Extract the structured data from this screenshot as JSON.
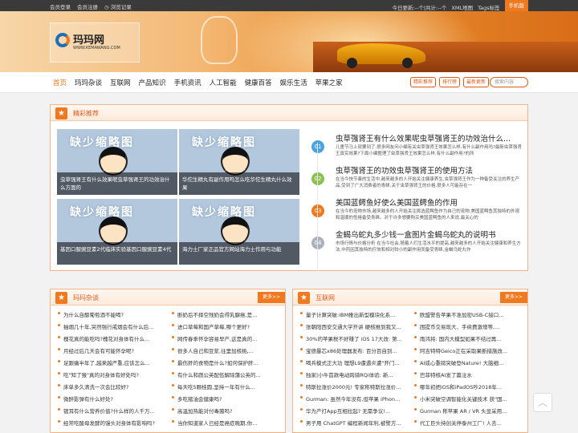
{
  "topbar": {
    "login": "会员登录",
    "register": "会员注册",
    "history": "浏览记录",
    "update": "今日更新:--个|共计:--个",
    "xml": "XML地图",
    "tags": "Tags标签",
    "mobile": "手机版"
  },
  "logo": {
    "name": "玛玛网",
    "url": "WWW.KEMAWANG.COM"
  },
  "nav": {
    "items": [
      "首页",
      "玛玛杂谈",
      "互联网",
      "产品知识",
      "手机资讯",
      "人工智能",
      "健康百答",
      "娱乐生活",
      "苹果之家"
    ],
    "btn_recommend": "精彩推荐",
    "btn_rank": "排行榜",
    "btn_latest": "最新更新",
    "search_placeholder": "搜索内容"
  },
  "featured": {
    "title": "精彩推荐",
    "thumb_placeholder": "缺少缩略图",
    "thumbs": [
      {
        "caption": "虫草强肾王有什么效果呢虫草强肾王的功效治什么方面的"
      },
      {
        "caption": "华佗生精丸有副作用吗怎么吃华佗生精丸什么效果"
      },
      {
        "caption": "基因口服豌豆素2代临床实验基因口服豌豆素4代"
      },
      {
        "caption": "海力士厂家正品官方网站海力士作用与功能"
      }
    ],
    "items": [
      {
        "num": "01",
        "color": "#4aa3df",
        "title": "虫草强肾王有什么效果呢虫草强肾王的功效治什么...",
        "desc": "儿童节马上就要到了,很多网友问小编有关虫草强肾王效果怎么样,有什么副作用吗?最新虫草强肾王真实效果?下面小编整理了虫草强肾王效果怎么样,有什么副作用?的所"
      },
      {
        "num": "02",
        "color": "#8cc152",
        "title": "虫草强肾王的功效虫草强肾王的使用方法",
        "desc": "在当今快节奏的生活中,越来越多的人开始关注健康养生,虫草强肾王作为一种备受关注的养生产品,受到了广大消费者的青睐,关于虫草强肾王的价格,很多人可能存在一"
      },
      {
        "num": "03",
        "color": "#f0781e",
        "title": "美国蓝鳄鱼好使么美国蓝鳄鱼的作用",
        "desc": "在当今的宠物市场,越来越多的人开始关注挑选蓝鳄鱼作为自己的宠物,美国蓝鳄鱼其独特的外观和温顺的性格备受青睐。对于许多想要购买美国蓝鳄鱼的人来说,最关心的"
      },
      {
        "num": "04",
        "color": "#aab2bd",
        "title": "金蝎乌蛇丸多少钱一盒图片金蝎乌蛇丸的说明书",
        "desc": "市场行情与价格分析 在当今社会,随着人们生活水平的提高,越来越多的人开始关注健康和养生方法,中药因其独特的疗效和相对较小的副作用而备受青睐,金蝎乌蛇丸作"
      }
    ]
  },
  "section_left": {
    "title": "玛玛杂谈",
    "more": "更多>>",
    "col1": [
      "为什么自酿葡萄酒不能喝?",
      "抽烟几十年,突然强行戒烟会有什么后...",
      "槐花真的能吃吗?槐花对身体有什么...",
      "月经过后几天会有可能怀孕呢?",
      "足跟痛半年了,越来越严重,应该怎么...",
      "吃\"知了猴\"真的对身体有好处吗?",
      "床单多久清洗一次会比较好?",
      "微醉影弹有什么好处?",
      "镀耳有什么营养价值?什么样的人千万...",
      "经常吃酸母发酵的馒头对身体有影响吗?"
    ],
    "col2": [
      "断奶后不择空残奶会得乳腺癌,是...",
      "进口草莓和国产草莓,哪个更好?",
      "网传春季怀孕容易早产,这是真的...",
      "很多人自己和豆浆,往里加核桃,...",
      "最伤肝的食物是什么?如何保护肝...",
      "有什么和蔬公英配伍解除蒲公英的...",
      "每天吃5颗桂圆,坚持一年有什么...",
      "多吃猪油会健康吗?",
      "高温加热能对付毒菌吗?",
      "当你知道家人已经是癌症晚期,你..."
    ]
  },
  "section_right": {
    "title": "互联网",
    "more": "更多>>",
    "col1": [
      "量子计算突破:IBM推出新型模块化系...",
      "张朝阳西安交通大学开讲 硬核推到我又...",
      "30%的苹果税不好赚了 iOS 17大改: 第...",
      "宝德暴芯x86处理器发布: 百分百自到...",
      "喝兵模式正大功 理想L9遭遇炎遭\"开门...",
      "独家|小牛首款电动跨骑RQi体验: 新...",
      "特斯拉涨价2000元! 专家称特斯拉涨价...",
      "Gurman: 虽然今年没有,但苹果 iPhon...",
      "华为产打App互相拉起? 无需争议!...",
      "男子用 ChatGPT 编程新闻年利,被警方..."
    ],
    "col2": [
      "欧盟警告苹果不准加密USB-C接口...",
      "困提币交易现大、手续费激增等,...",
      "雨鸿将: 国内大模型如果不结过再...",
      "阿吉特特Geico正在采取果断措施改...",
      "AI成心重磅突破登Nature! 大脑细...",
      "巴菲特核AI发了篇注水",
      "哪年初把iOS和iPadOS吵2018年...",
      "小米突破空调智能化关键技术 获\"国...",
      "Gurman 称苹果 AR / VR 头显采用...",
      "代工巨头持创关停泰州工厂! 人去..."
    ]
  },
  "totop": "︿"
}
